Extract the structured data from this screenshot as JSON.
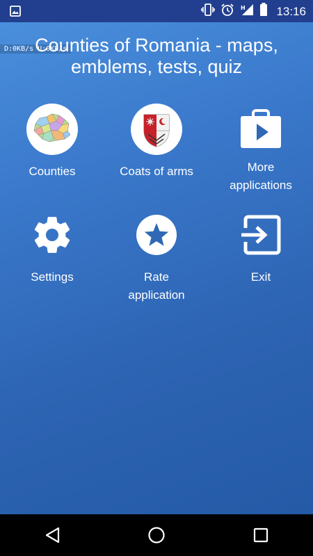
{
  "status_bar": {
    "time": "13:16",
    "icons": [
      "image-notification-icon",
      "vibrate-icon",
      "alarm-icon",
      "signal-h-icon",
      "battery-icon"
    ]
  },
  "net_speed": "D:0KB/s  U:0KB/s",
  "title_line1": "Counties of Romania - maps,",
  "title_line2": "emblems, tests, quiz",
  "tiles": [
    {
      "label": "Counties",
      "icon": "romania-map-icon"
    },
    {
      "label": "Coats of arms",
      "icon": "coat-of-arms-icon"
    },
    {
      "label_line1": "More",
      "label_line2": "applications",
      "icon": "play-store-bag-icon"
    },
    {
      "label": "Settings",
      "icon": "gear-icon"
    },
    {
      "label_line1": "Rate",
      "label_line2": "application",
      "icon": "star-icon"
    },
    {
      "label": "Exit",
      "icon": "exit-icon"
    }
  ],
  "nav": [
    "back-icon",
    "home-icon",
    "recents-icon"
  ],
  "colors": {
    "background_top": "#4a8fdc",
    "background_bottom": "#245aa6",
    "status_bar": "#223f8f",
    "nav_bar": "#000000"
  }
}
